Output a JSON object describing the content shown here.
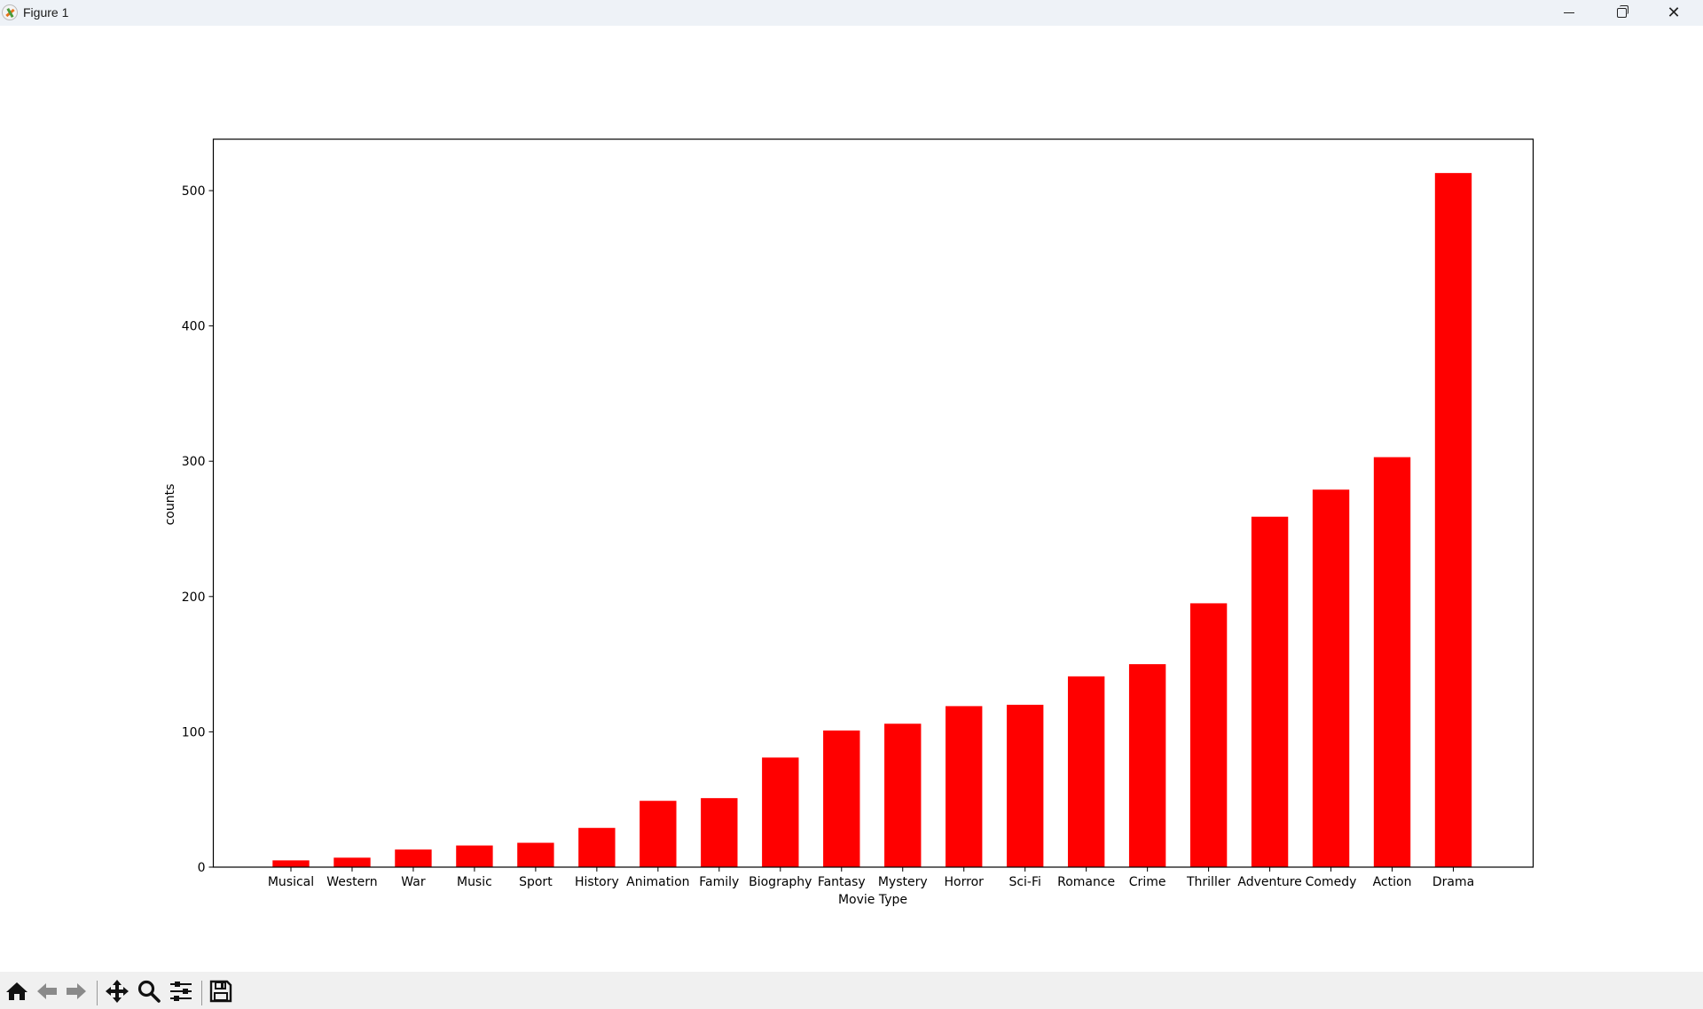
{
  "window": {
    "title": "Figure 1",
    "icon": "matplotlib-icon",
    "controls": {
      "minimize": "minimize-icon",
      "maximize": "restore-icon",
      "close": "close-icon"
    },
    "close_glyph": "✕"
  },
  "toolbar": {
    "buttons": [
      {
        "name": "home-button",
        "icon": "home-icon"
      },
      {
        "name": "back-button",
        "icon": "arrow-left-icon"
      },
      {
        "name": "forward-button",
        "icon": "arrow-right-icon"
      },
      {
        "name": "pan-button",
        "icon": "move-icon"
      },
      {
        "name": "zoom-button",
        "icon": "magnifier-icon"
      },
      {
        "name": "configure-subplots-button",
        "icon": "sliders-icon"
      },
      {
        "name": "save-button",
        "icon": "floppy-disk-icon"
      }
    ]
  },
  "chart_data": {
    "type": "bar",
    "title": "",
    "xlabel": "Movie Type",
    "ylabel": "counts",
    "categories": [
      "Musical",
      "Western",
      "War",
      "Music",
      "Sport",
      "History",
      "Animation",
      "Family",
      "Biography",
      "Fantasy",
      "Mystery",
      "Horror",
      "Sci-Fi",
      "Romance",
      "Crime",
      "Thriller",
      "Adventure",
      "Comedy",
      "Action",
      "Drama"
    ],
    "values": [
      5,
      7,
      13,
      16,
      18,
      29,
      49,
      51,
      81,
      101,
      106,
      119,
      120,
      141,
      150,
      195,
      259,
      279,
      303,
      513
    ],
    "ylim": [
      0,
      538
    ],
    "yticks": [
      0,
      100,
      200,
      300,
      400,
      500
    ],
    "bar_color": "#ff0000",
    "grid": false,
    "legend": "none"
  }
}
